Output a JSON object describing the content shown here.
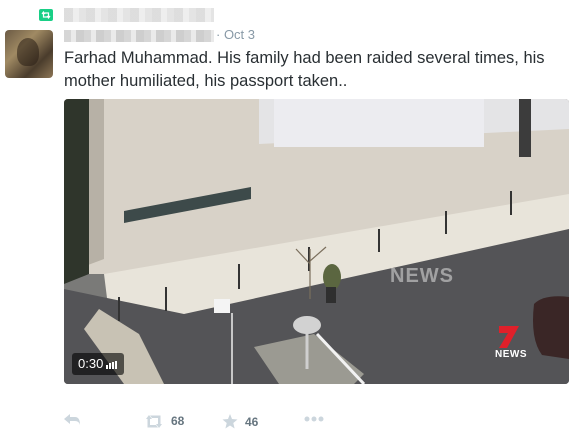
{
  "tweet": {
    "timestamp": "· Oct 3",
    "text": "Farhad Muhammad. His family had been raided several times, his mother humiliated, his passport taken.."
  },
  "media": {
    "duration": "0:30",
    "watermark": "NEWS",
    "logo_text": "NEWS"
  },
  "actions": {
    "retweet_count": "68",
    "favorite_count": "46"
  }
}
